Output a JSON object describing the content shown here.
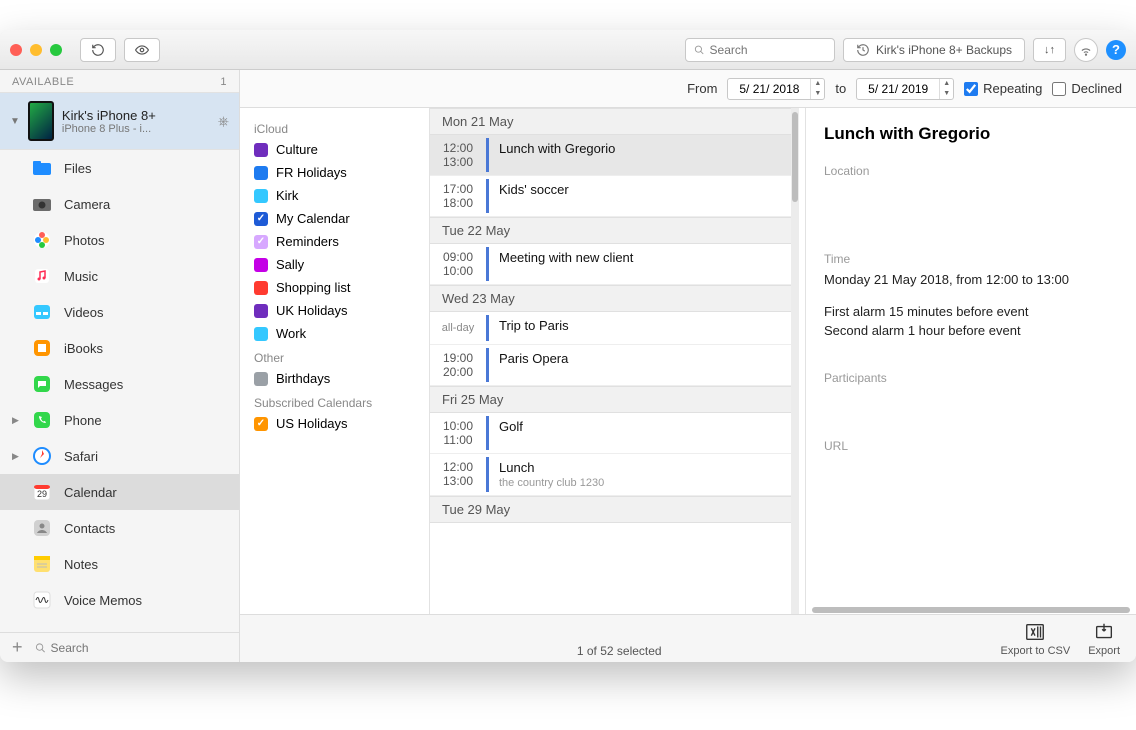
{
  "toolbar": {
    "search_placeholder": "Search",
    "backups_label": "Kirk's iPhone 8+ Backups"
  },
  "sidebar": {
    "header": "AVAILABLE",
    "count": "1",
    "device": {
      "name": "Kirk's iPhone 8+",
      "subtitle": "iPhone 8 Plus - i..."
    },
    "items": [
      {
        "label": "Files",
        "icon": "folder",
        "color": "#1e8cff"
      },
      {
        "label": "Camera",
        "icon": "camera",
        "color": "#6b6b6b"
      },
      {
        "label": "Photos",
        "icon": "photos",
        "color": "#ffffff"
      },
      {
        "label": "Music",
        "icon": "music",
        "color": "#ffffff"
      },
      {
        "label": "Videos",
        "icon": "videos",
        "color": "#34c8ff"
      },
      {
        "label": "iBooks",
        "icon": "ibooks",
        "color": "#ff9500"
      },
      {
        "label": "Messages",
        "icon": "messages",
        "color": "#32d74b"
      },
      {
        "label": "Phone",
        "icon": "phone",
        "color": "#32d74b",
        "disclosure": true
      },
      {
        "label": "Safari",
        "icon": "safari",
        "color": "#1e8cff",
        "disclosure": true
      },
      {
        "label": "Calendar",
        "icon": "calendar",
        "color": "#ffffff",
        "selected": true
      },
      {
        "label": "Contacts",
        "icon": "contacts",
        "color": "#d0d0d0"
      },
      {
        "label": "Notes",
        "icon": "notes",
        "color": "#ffe070"
      },
      {
        "label": "Voice Memos",
        "icon": "voice",
        "color": "#ffffff"
      }
    ],
    "footer_search_placeholder": "Search"
  },
  "filter": {
    "from_label": "From",
    "from_date": "5/ 21/ 2018",
    "to_label": "to",
    "to_date": "5/ 21/ 2019",
    "repeating_label": "Repeating",
    "repeating_checked": true,
    "declined_label": "Declined",
    "declined_checked": false
  },
  "calendars": {
    "sections": [
      {
        "title": "iCloud",
        "items": [
          {
            "label": "Culture",
            "color": "#6f2dbd",
            "checked": false
          },
          {
            "label": "FR Holidays",
            "color": "#1e7bf0",
            "checked": false
          },
          {
            "label": "Kirk",
            "color": "#34c8ff",
            "checked": false
          },
          {
            "label": "My Calendar",
            "color": "#1e5bd6",
            "checked": true
          },
          {
            "label": "Reminders",
            "color": "#d7a8ff",
            "checked": true,
            "light": true
          },
          {
            "label": "Sally",
            "color": "#c400e6",
            "checked": false
          },
          {
            "label": "Shopping list",
            "color": "#ff3b30",
            "checked": false
          },
          {
            "label": "UK Holidays",
            "color": "#6f2dbd",
            "checked": false
          },
          {
            "label": "Work",
            "color": "#34c8ff",
            "checked": false
          }
        ]
      },
      {
        "title": "Other",
        "items": [
          {
            "label": "Birthdays",
            "color": "#9aa0a6",
            "checked": false
          }
        ]
      },
      {
        "title": "Subscribed Calendars",
        "items": [
          {
            "label": "US Holidays",
            "color": "#ff9500",
            "checked": true
          }
        ]
      }
    ]
  },
  "events": [
    {
      "day": "Mon 21 May",
      "rows": [
        {
          "start": "12:00",
          "end": "13:00",
          "title": "Lunch with Gregorio",
          "selected": true
        },
        {
          "start": "17:00",
          "end": "18:00",
          "title": "Kids' soccer"
        }
      ]
    },
    {
      "day": "Tue 22 May",
      "rows": [
        {
          "start": "09:00",
          "end": "10:00",
          "title": "Meeting with new client"
        }
      ]
    },
    {
      "day": "Wed 23 May",
      "rows": [
        {
          "allday": true,
          "title": "Trip to Paris"
        },
        {
          "start": "19:00",
          "end": "20:00",
          "title": "Paris Opera"
        }
      ]
    },
    {
      "day": "Fri 25 May",
      "rows": [
        {
          "start": "10:00",
          "end": "11:00",
          "title": "Golf"
        },
        {
          "start": "12:00",
          "end": "13:00",
          "title": "Lunch",
          "location": "the country club 1230"
        }
      ]
    },
    {
      "day": "Tue 29 May",
      "rows": []
    }
  ],
  "detail": {
    "title": "Lunch with Gregorio",
    "location_label": "Location",
    "time_label": "Time",
    "time_body_1": "Monday 21 May 2018, from 12:00 to 13:00",
    "time_body_2": "First alarm 15 minutes before event",
    "time_body_3": "Second alarm 1 hour before event",
    "participants_label": "Participants",
    "url_label": "URL"
  },
  "footer": {
    "status": "1 of 52 selected",
    "export_csv": "Export to CSV",
    "export": "Export"
  }
}
